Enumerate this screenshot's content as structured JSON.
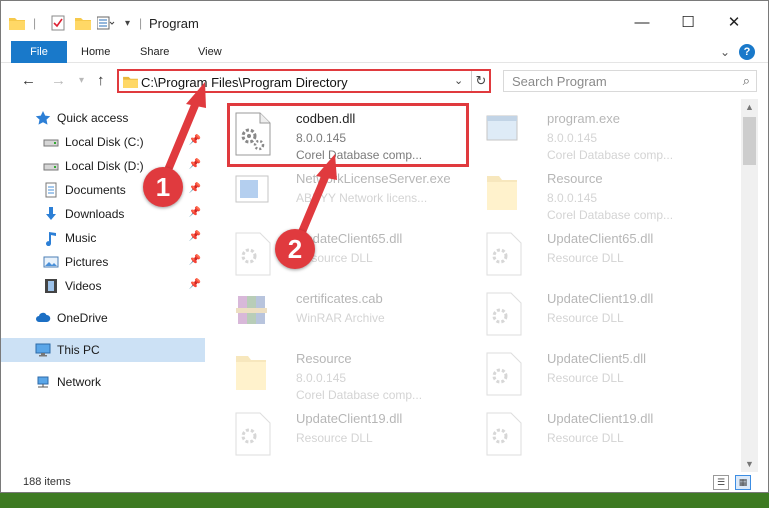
{
  "window": {
    "title": "Program",
    "minimize": "—",
    "maximize": "☐",
    "close": "✕"
  },
  "ribbon": {
    "tabs": [
      "File",
      "Home",
      "Share",
      "View"
    ],
    "expand_icon": "chevron-down-icon",
    "help": "?"
  },
  "address": {
    "path": "C:\\Program Files\\Program Directory",
    "search_placeholder": "Search Program"
  },
  "sidebar": {
    "items": [
      {
        "label": "Quick access",
        "icon": "star-icon",
        "pinned": false
      },
      {
        "label": "Local Disk (C:)",
        "icon": "drive-icon",
        "pinned": true
      },
      {
        "label": "Local Disk (D:)",
        "icon": "drive-icon",
        "pinned": true
      },
      {
        "label": "Documents",
        "icon": "documents-icon",
        "pinned": true
      },
      {
        "label": "Downloads",
        "icon": "download-arrow-icon",
        "pinned": true
      },
      {
        "label": "Music",
        "icon": "music-note-icon",
        "pinned": true
      },
      {
        "label": "Pictures",
        "icon": "pictures-icon",
        "pinned": true
      },
      {
        "label": "Videos",
        "icon": "film-icon",
        "pinned": true
      },
      {
        "label": "OneDrive",
        "icon": "cloud-icon",
        "pinned": false
      },
      {
        "label": "This PC",
        "icon": "monitor-icon",
        "pinned": false,
        "selected": true
      },
      {
        "label": "Network",
        "icon": "network-icon",
        "pinned": false
      }
    ]
  },
  "files": [
    {
      "name": "codben.dll",
      "line2": "8.0.0.145",
      "line3": "Corel Database comp...",
      "kind": "dll",
      "highlighted": true
    },
    {
      "name": "program.exe",
      "line2": "8.0.0.145",
      "line3": "Corel Database comp...",
      "kind": "exe"
    },
    {
      "name": "NetworkLicenseServer.exe",
      "line2": "ABBYY Network licens...",
      "line3": "",
      "kind": "app"
    },
    {
      "name": "Resource",
      "line2": "8.0.0.145",
      "line3": "Corel Database comp...",
      "kind": "folder"
    },
    {
      "name": "UpdateClient65.dll",
      "line2": "Resource DLL",
      "line3": "",
      "kind": "dll"
    },
    {
      "name": "UpdateClient65.dll",
      "line2": "Resource DLL",
      "line3": "",
      "kind": "dll"
    },
    {
      "name": "certificates.cab",
      "line2": "WinRAR Archive",
      "line3": "",
      "kind": "archive"
    },
    {
      "name": "UpdateClient19.dll",
      "line2": "Resource DLL",
      "line3": "",
      "kind": "dll"
    },
    {
      "name": "Resource",
      "line2": "8.0.0.145",
      "line3": "Corel Database comp...",
      "kind": "folder"
    },
    {
      "name": "UpdateClient5.dll",
      "line2": "Resource DLL",
      "line3": "",
      "kind": "dll"
    },
    {
      "name": "UpdateClient19.dll",
      "line2": "Resource DLL",
      "line3": "",
      "kind": "dll"
    },
    {
      "name": "UpdateClient19.dll",
      "line2": "Resource DLL",
      "line3": "",
      "kind": "dll"
    }
  ],
  "status": {
    "item_count": "188 items"
  },
  "annotations": {
    "step1": "1",
    "step2": "2",
    "color": "#e03a3e"
  },
  "colors": {
    "accent": "#1979ca",
    "selection": "#cce1f5",
    "highlight": "#e03a3e"
  }
}
